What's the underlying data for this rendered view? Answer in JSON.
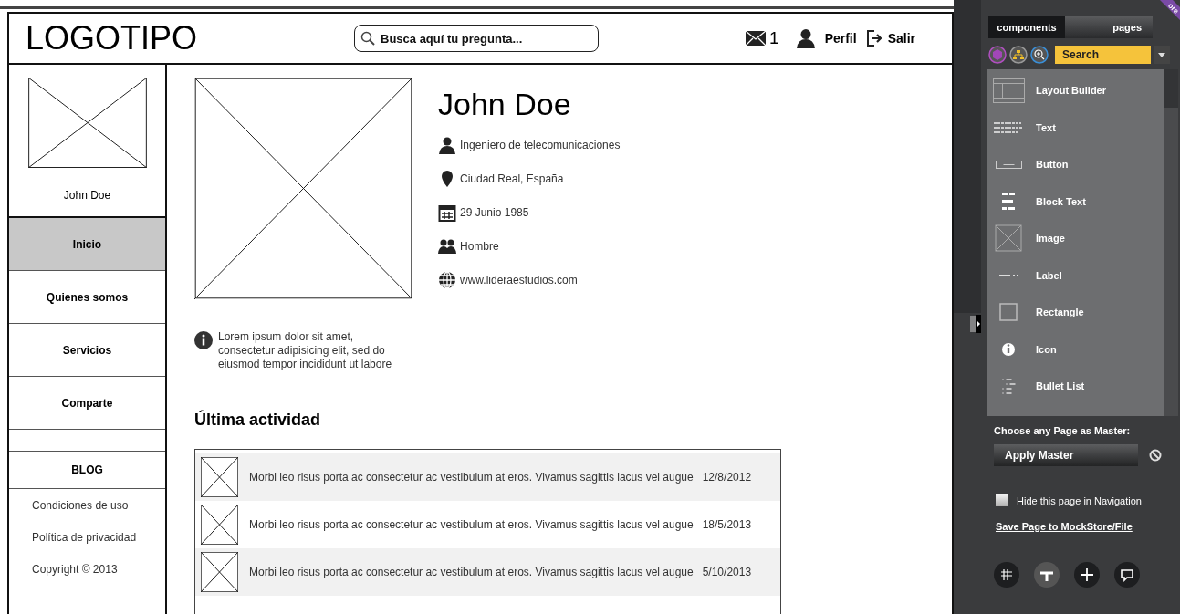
{
  "header": {
    "logo": "LOGOTIPO",
    "search": {
      "placeholder": "Busca aquí tu pregunta..."
    },
    "messages_count": "1",
    "profile": "Perfil",
    "logout": "Salir"
  },
  "sidebar": {
    "user_name": "John Doe",
    "nav": [
      {
        "label": "Inicio",
        "selected": true
      },
      {
        "label": "Quienes somos",
        "selected": false
      },
      {
        "label": "Servicios",
        "selected": false
      },
      {
        "label": "Comparte",
        "selected": false
      }
    ],
    "blog": "BLOG",
    "footer_links": [
      "Condiciones de uso",
      "Política de privacidad",
      "Copyright © 2013"
    ]
  },
  "profile": {
    "name": "John Doe",
    "details": [
      {
        "kind": "job",
        "text": "Ingeniero de telecomunicaciones"
      },
      {
        "kind": "location",
        "text": "Ciudad Real, España"
      },
      {
        "kind": "date",
        "text": "29 Junio 1985"
      },
      {
        "kind": "gender",
        "text": "Hombre"
      },
      {
        "kind": "web",
        "text": "www.lideraestudios.com"
      }
    ],
    "bio": "Lorem ipsum dolor sit amet, consectetur adipisicing elit, sed do eiusmod tempor incididunt ut labore"
  },
  "activity": {
    "title": "Última actividad",
    "rows": [
      {
        "text": "Morbi leo risus porta ac consectetur ac vestibulum at eros. Vivamus sagittis lacus vel augue",
        "date": "12/8/2012"
      },
      {
        "text": "Morbi leo risus porta ac consectetur ac vestibulum at eros. Vivamus sagittis lacus vel augue",
        "date": "18/5/2013"
      },
      {
        "text": "Morbi leo risus porta ac consectetur ac vestibulum at eros. Vivamus sagittis lacus vel augue",
        "date": "5/10/2013"
      }
    ]
  },
  "editor_panel": {
    "ribbon": "ore",
    "tabs": [
      {
        "label": "components",
        "selected": true
      },
      {
        "label": "pages",
        "selected": false
      }
    ],
    "search": {
      "value": "Search"
    },
    "components": [
      {
        "kind": "layout",
        "label": "Layout Builder"
      },
      {
        "kind": "text",
        "label": "Text"
      },
      {
        "kind": "button",
        "label": "Button"
      },
      {
        "kind": "blocktext",
        "label": "Block Text"
      },
      {
        "kind": "image",
        "label": "Image"
      },
      {
        "kind": "label",
        "label": "Label"
      },
      {
        "kind": "rectangle",
        "label": "Rectangle"
      },
      {
        "kind": "icon",
        "label": "Icon"
      },
      {
        "kind": "bullets",
        "label": "Bullet List"
      }
    ],
    "master_title": "Choose any Page as Master:",
    "apply_master": "Apply Master",
    "hide_in_nav": {
      "label": "Hide this page in Navigation",
      "checked": false
    },
    "save_link": "Save Page to MockStore/File"
  }
}
